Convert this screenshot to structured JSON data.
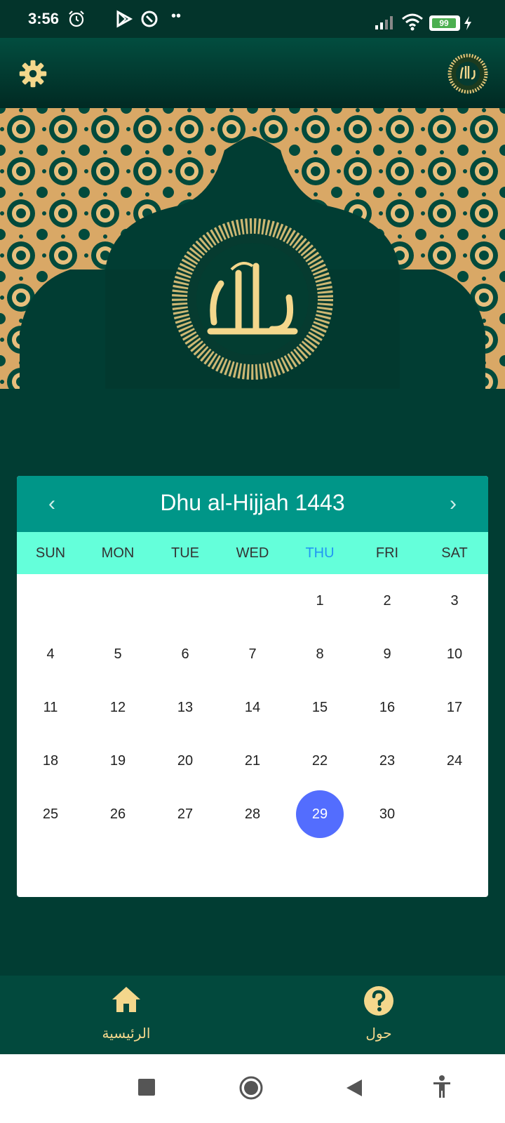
{
  "status_bar": {
    "time": "3:56",
    "battery_level": "99",
    "icons": [
      "alarm-icon",
      "play-store-icon",
      "data-saver-icon",
      "more-notifications-icon",
      "signal-icon",
      "wifi-icon",
      "battery-icon",
      "charging-icon"
    ]
  },
  "app_bar": {
    "settings_icon": "gear-icon",
    "logo_icon": "allah-calligraphy-icon"
  },
  "colors": {
    "background": "#013d33",
    "calendar_header": "#009688",
    "weekday_row": "#64ffda",
    "today_weekday": "#2196f3",
    "selected_day": "#536dfe",
    "gold_accent": "#f4d78c"
  },
  "calendar": {
    "title": "Dhu al-Hijjah 1443",
    "prev_icon": "chevron-left-icon",
    "next_icon": "chevron-right-icon",
    "weekdays": [
      "SUN",
      "MON",
      "TUE",
      "WED",
      "THU",
      "FRI",
      "SAT"
    ],
    "highlighted_weekday": "THU",
    "leading_blank_days": 4,
    "days": [
      "1",
      "2",
      "3",
      "4",
      "5",
      "6",
      "7",
      "8",
      "9",
      "10",
      "11",
      "12",
      "13",
      "14",
      "15",
      "16",
      "17",
      "18",
      "19",
      "20",
      "21",
      "22",
      "23",
      "24",
      "25",
      "26",
      "27",
      "28",
      "29",
      "30"
    ],
    "selected_day": "29"
  },
  "bottom_nav": {
    "items": [
      {
        "label": "الرئيسية",
        "icon": "home-icon"
      },
      {
        "label": "حول",
        "icon": "help-icon"
      }
    ]
  },
  "system_nav": {
    "buttons": [
      "recents-button",
      "home-button",
      "back-button",
      "accessibility-button"
    ]
  }
}
